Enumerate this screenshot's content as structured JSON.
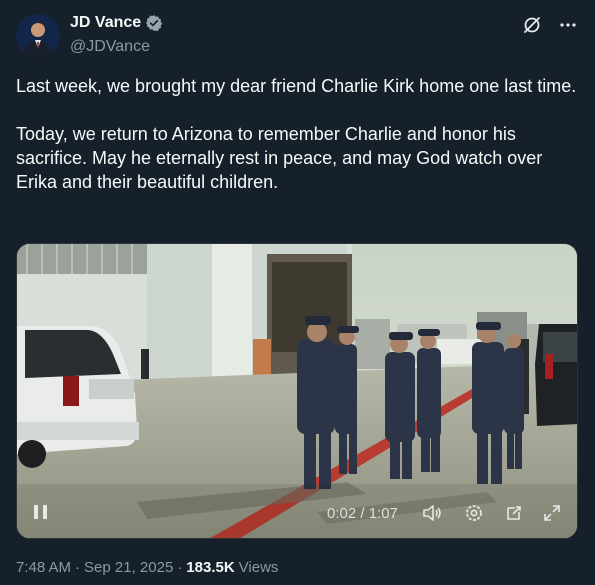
{
  "author": {
    "display_name": "JD Vance",
    "handle": "@JDVance",
    "verified": true
  },
  "tweet": {
    "paragraph_1": "Last week, we brought my dear friend Charlie Kirk home one last time.",
    "paragraph_2": "Today, we return to Arizona to remember Charlie and honor his sacrifice. May he eternally rest in peace, and may God watch over Erika and their beautiful children."
  },
  "video": {
    "time": "0:02 / 1:07"
  },
  "meta": {
    "time": "7:48 AM",
    "separator_1": "·",
    "date": "Sep 21, 2025",
    "separator_2": "·",
    "views_count": "183.5K",
    "views_label": "Views"
  },
  "colors": {
    "background": "#15202b",
    "text_primary": "#f7f9f9",
    "text_secondary": "#8b98a5",
    "verified": "#9aa4ad"
  },
  "icons": [
    "verified-badge-icon",
    "grok-icon",
    "more-icon",
    "pause-icon",
    "volume-icon",
    "settings-icon",
    "share-icon",
    "fullscreen-icon"
  ]
}
